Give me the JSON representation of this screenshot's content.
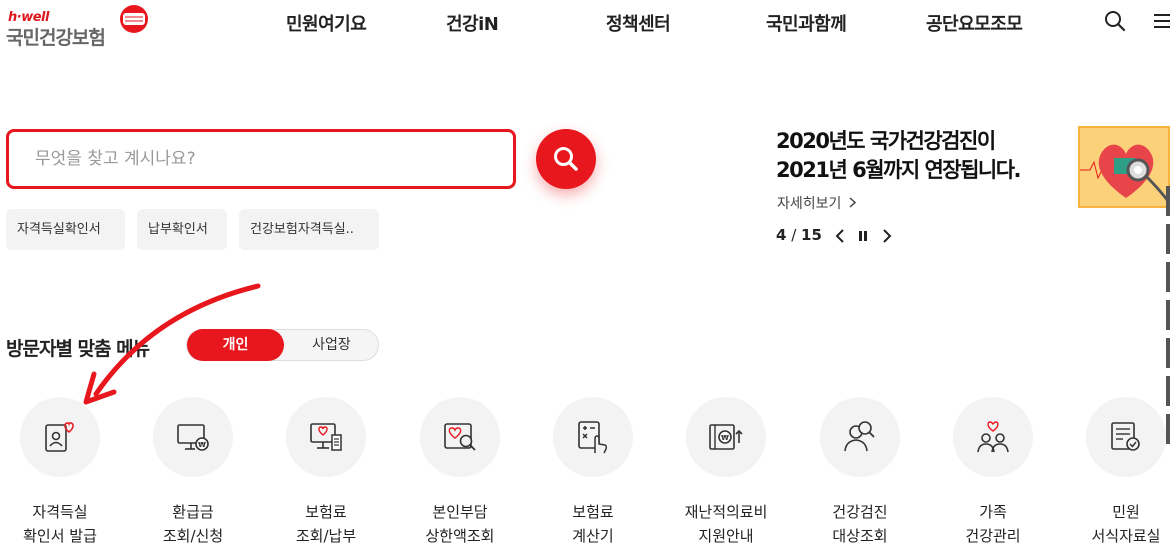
{
  "header": {
    "logo_tag": "h·well",
    "logo_name": "국민건강보험",
    "nav": [
      "민원여기요",
      "건강iN",
      "정책센터",
      "국민과함께",
      "공단요모조모"
    ],
    "search_icon": "search-icon",
    "menu_icon": "hamburger-menu-icon"
  },
  "search": {
    "placeholder": "무엇을 찾고 계시나요?",
    "value": "",
    "button_icon": "search-icon",
    "keywords": [
      "자격득실확인서",
      "납부확인서",
      "건강보험자격득실.."
    ]
  },
  "banner": {
    "title_line1": "2020년도 국가건강검진이",
    "title_line2": "2021년 6월까지 연장됩니다.",
    "more": "자세히보기",
    "current": "4",
    "separator": " / ",
    "total": "15",
    "controls": [
      "chevron-left-icon",
      "pause-icon",
      "chevron-right-icon"
    ],
    "image_icon": "heart-stethoscope-icon"
  },
  "visitor_menu": {
    "title": "방문자별 맞춤 메뉴",
    "tabs": [
      "개인",
      "사업장"
    ],
    "active_tab": "개인",
    "items": [
      {
        "line1": "자격득실",
        "line2": "확인서 발급",
        "icon": "id-card-heart-icon"
      },
      {
        "line1": "환급금",
        "line2": "조회/신청",
        "icon": "monitor-won-icon"
      },
      {
        "line1": "보험료",
        "line2": "조회/납부",
        "icon": "monitor-receipt-icon"
      },
      {
        "line1": "본인부담",
        "line2": "상한액조회",
        "icon": "heart-search-icon"
      },
      {
        "line1": "보험료",
        "line2": "계산기",
        "icon": "calculator-hand-icon"
      },
      {
        "line1": "재난적의료비",
        "line2": "지원안내",
        "icon": "wallet-won-icon"
      },
      {
        "line1": "건강검진",
        "line2": "대상조회",
        "icon": "person-search-icon"
      },
      {
        "line1": "가족",
        "line2": "건강관리",
        "icon": "family-heart-icon"
      },
      {
        "line1": "민원",
        "line2": "서식자료실",
        "icon": "document-check-icon"
      }
    ]
  },
  "colors": {
    "accent": "#e8161d",
    "toggle_bg": "#f5f5f5",
    "circle_bg": "#f3f3f3"
  }
}
